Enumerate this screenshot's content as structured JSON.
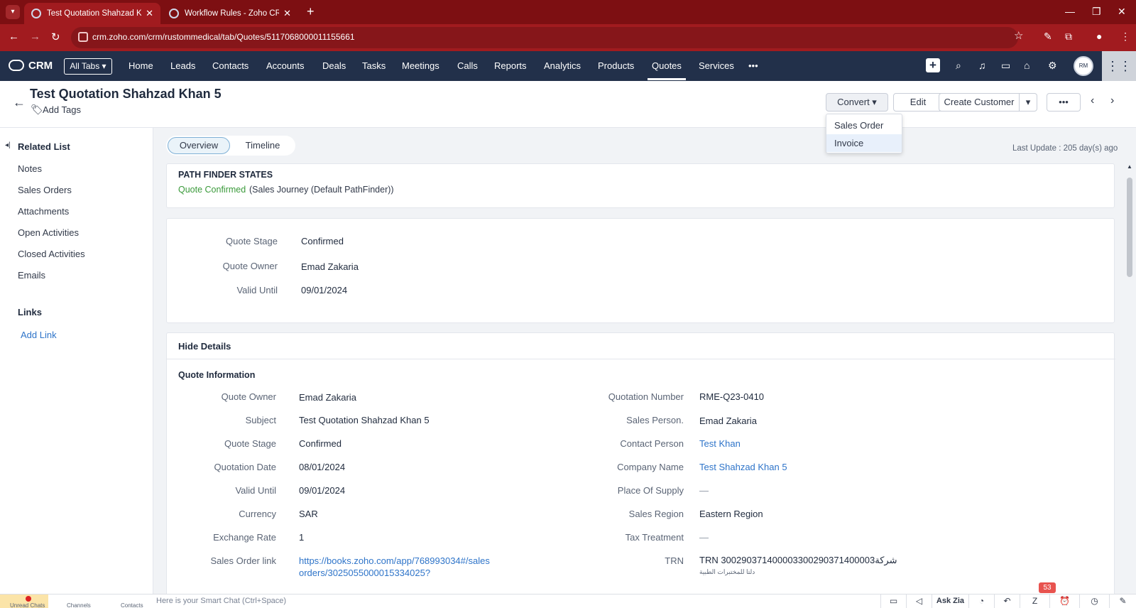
{
  "browser": {
    "tabs": [
      {
        "title": "Test Quotation Shahzad Khan 5",
        "active": true
      },
      {
        "title": "Workflow Rules - Zoho CRM",
        "active": false
      }
    ],
    "url": "crm.zoho.com/crm/rustommedical/tab/Quotes/5117068000011155661"
  },
  "crm_nav": {
    "logo": "CRM",
    "all_tabs": "All Tabs",
    "items": [
      "Home",
      "Leads",
      "Contacts",
      "Accounts",
      "Deals",
      "Tasks",
      "Meetings",
      "Calls",
      "Reports",
      "Analytics",
      "Products",
      "Quotes",
      "Services"
    ],
    "active": "Quotes",
    "more": "•••"
  },
  "record": {
    "title": "Test Quotation Shahzad Khan 5",
    "add_tags": "Add Tags",
    "buttons": {
      "convert": "Convert",
      "edit": "Edit",
      "create_customer": "Create Customer",
      "more": "•••"
    },
    "convert_menu": [
      "Sales Order",
      "Invoice"
    ],
    "last_update": "Last Update : 205 day(s) ago"
  },
  "sidebar": {
    "related_list": "Related List",
    "items": [
      "Notes",
      "Sales Orders",
      "Attachments",
      "Open Activities",
      "Closed Activities",
      "Emails"
    ],
    "links_title": "Links",
    "add_link": "Add Link"
  },
  "view_toggle": {
    "overview": "Overview",
    "timeline": "Timeline"
  },
  "pathfinder": {
    "title": "PATH FINDER STATES",
    "state": "Quote Confirmed",
    "journey": "(Sales Journey (Default PathFinder))"
  },
  "summary": [
    {
      "label": "Quote Stage",
      "value": "Confirmed"
    },
    {
      "label": "Quote Owner",
      "value": "Emad Zakaria"
    },
    {
      "label": "Valid Until",
      "value": "09/01/2024"
    }
  ],
  "details": {
    "hide_details": "Hide Details",
    "section": "Quote Information",
    "left": [
      {
        "label": "Quote Owner",
        "value": "Emad Zakaria"
      },
      {
        "label": "Subject",
        "value": "Test Quotation Shahzad Khan 5"
      },
      {
        "label": "Quote Stage",
        "value": "Confirmed"
      },
      {
        "label": "Quotation Date",
        "value": "08/01/2024"
      },
      {
        "label": "Valid Until",
        "value": "09/01/2024"
      },
      {
        "label": "Currency",
        "value": "SAR"
      },
      {
        "label": "Exchange Rate",
        "value": "1"
      },
      {
        "label": "Sales Order link",
        "value": "https://books.zoho.com/app/768993034#/sales",
        "value2": "orders/3025055000015334025?"
      }
    ],
    "right": [
      {
        "label": "Quotation Number",
        "value": "RME-Q23-0410"
      },
      {
        "label": "Sales Person.",
        "value": "Emad Zakaria"
      },
      {
        "label": "Contact Person",
        "value": "Test Khan"
      },
      {
        "label": "Company Name",
        "value": "Test Shahzad Khan 5"
      },
      {
        "label": "Place Of Supply",
        "value": "—"
      },
      {
        "label": "Sales Region",
        "value": "Eastern Region"
      },
      {
        "label": "Tax Treatment",
        "value": "—"
      },
      {
        "label": "TRN",
        "value": "TRN 300290371400003300290371400003شركة",
        "value2": "دلتا للمختبرات الطبية"
      }
    ]
  },
  "bottom_bar": {
    "chats": "Unread Chats",
    "channels": "Channels",
    "contacts": "Contacts",
    "smart_chat": "Here is your Smart Chat (Ctrl+Space)",
    "ask_zia": "Ask Zia",
    "badge": "53"
  }
}
